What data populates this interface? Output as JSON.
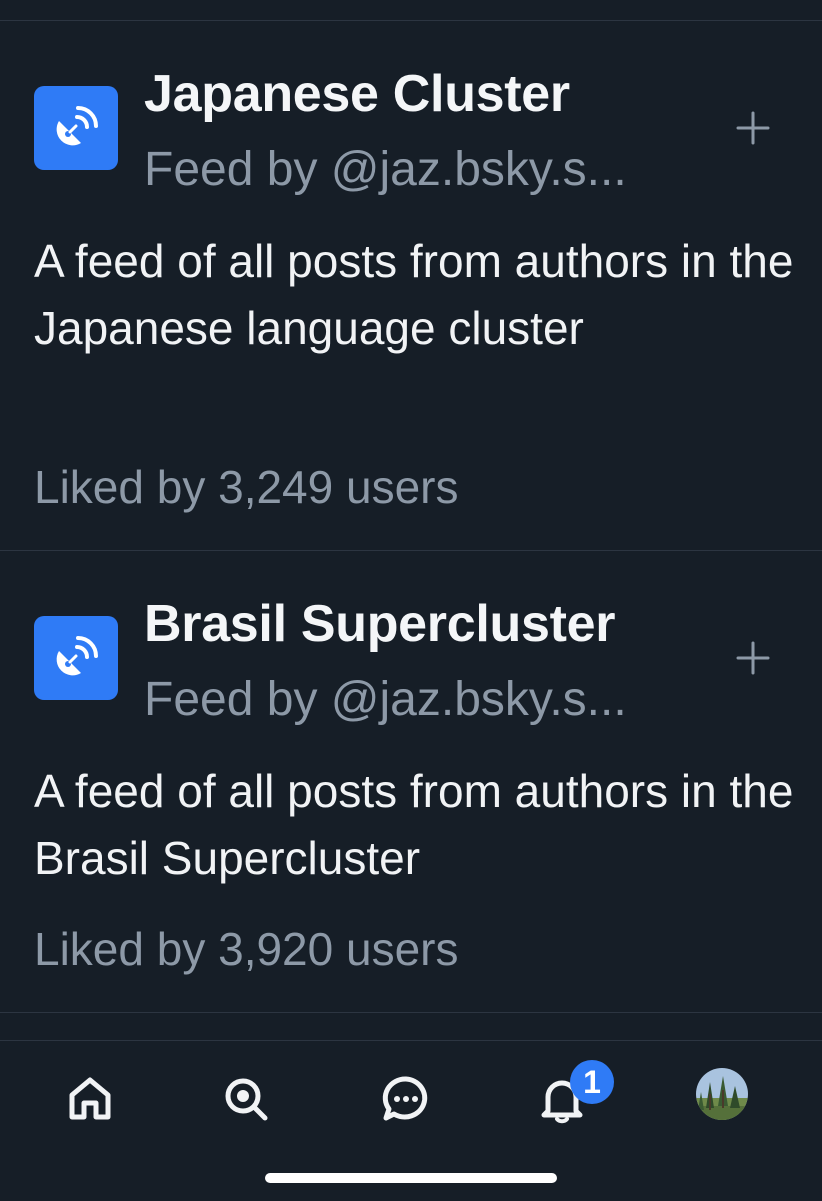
{
  "feeds": [
    {
      "title": "Japanese Cluster",
      "creator": "Feed by @jaz.bsky.s...",
      "description": "A feed of all posts from authors in the Japanese language cluster",
      "likes": "Liked by 3,249 users",
      "avatar_icon": "satellite-dish-icon",
      "add_icon": "plus-icon"
    },
    {
      "title": "Brasil Supercluster",
      "creator": "Feed by @jaz.bsky.s...",
      "description": "A feed of all posts from authors in the Brasil Supercluster",
      "likes": "Liked by 3,920 users",
      "avatar_icon": "satellite-dish-icon",
      "add_icon": "plus-icon"
    }
  ],
  "tab_bar": {
    "tabs": [
      {
        "icon": "home-icon"
      },
      {
        "icon": "search-icon"
      },
      {
        "icon": "chat-icon"
      },
      {
        "icon": "bell-icon",
        "badge": "1"
      },
      {
        "icon": "profile-avatar"
      }
    ]
  },
  "colors": {
    "background": "#161e27",
    "accent": "#2f7bf6",
    "muted_text": "#8d99a7",
    "divider": "#2c3541"
  }
}
